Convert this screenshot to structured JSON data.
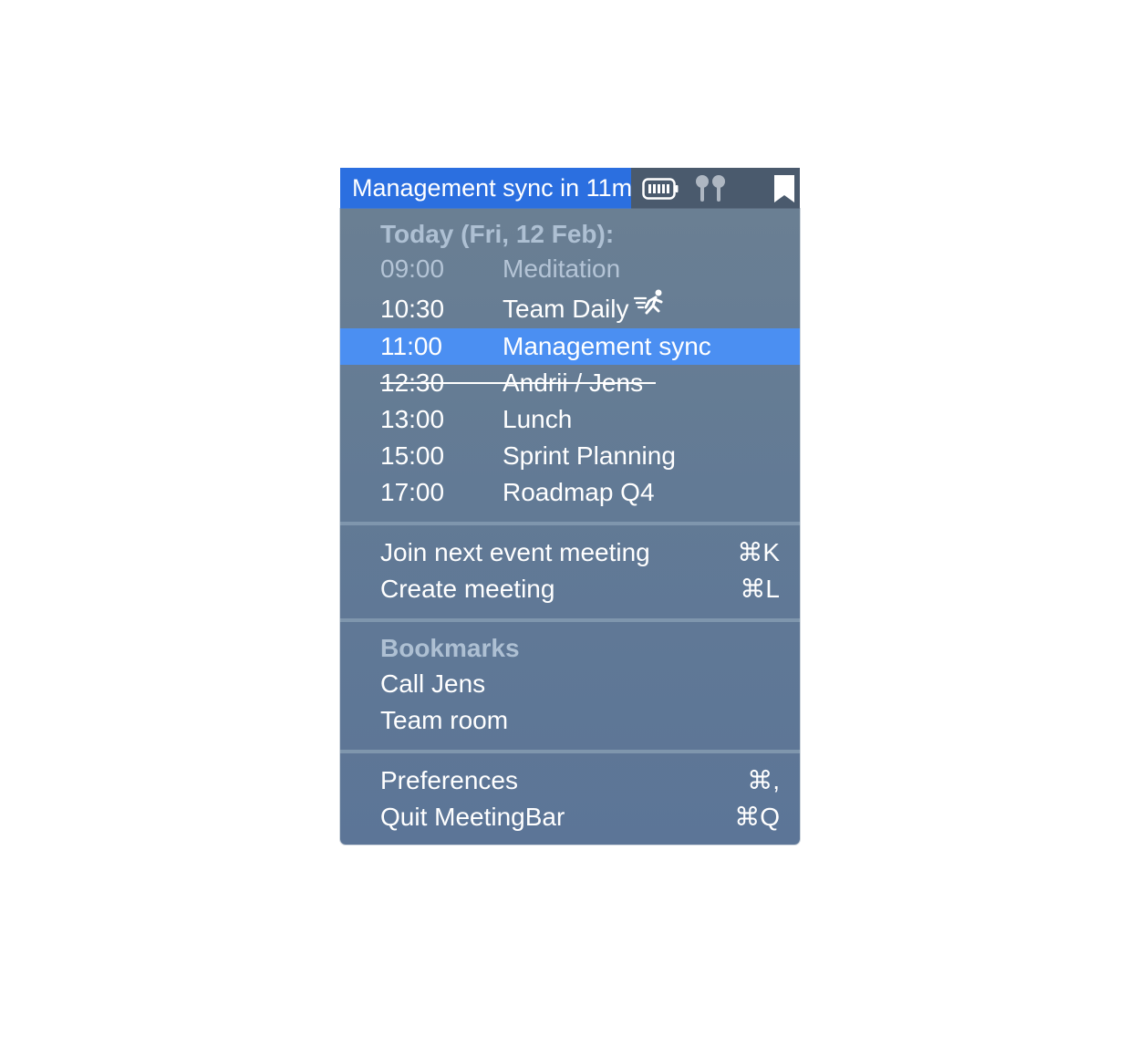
{
  "menubar": {
    "title": "Management sync in 11m",
    "icons": [
      "battery-icon",
      "airpods-icon",
      "bookmark-icon"
    ]
  },
  "today": {
    "header": "Today (Fri, 12 Feb):",
    "events": [
      {
        "time": "09:00",
        "title": "Meditation",
        "state": "past"
      },
      {
        "time": "10:30",
        "title": "Team Daily",
        "state": "normal",
        "icon": "running-icon"
      },
      {
        "time": "11:00",
        "title": "Management sync",
        "state": "highlighted"
      },
      {
        "time": "12:30",
        "title": "Andrii / Jens",
        "state": "declined"
      },
      {
        "time": "13:00",
        "title": "Lunch",
        "state": "normal"
      },
      {
        "time": "15:00",
        "title": "Sprint Planning",
        "state": "normal"
      },
      {
        "time": "17:00",
        "title": "Roadmap Q4",
        "state": "normal"
      }
    ]
  },
  "actions": [
    {
      "label": "Join next event meeting",
      "shortcut": "⌘K"
    },
    {
      "label": "Create meeting",
      "shortcut": "⌘L"
    }
  ],
  "bookmarks": {
    "header": "Bookmarks",
    "items": [
      "Call Jens",
      "Team room"
    ]
  },
  "app": [
    {
      "label": "Preferences",
      "shortcut": "⌘,"
    },
    {
      "label": "Quit MeetingBar",
      "shortcut": "⌘Q"
    }
  ],
  "colors": {
    "menubar_highlight": "#2b6fe0",
    "row_highlight": "#4b8ff2",
    "menu_background": "#627a95"
  }
}
